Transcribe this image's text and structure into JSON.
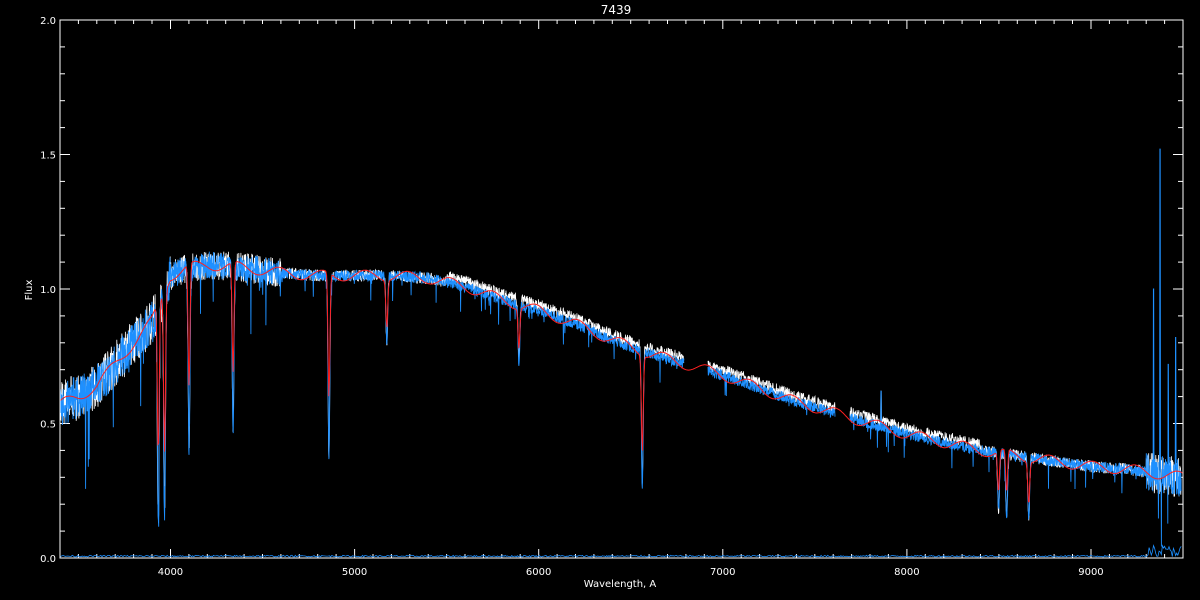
{
  "chart_data": {
    "type": "line",
    "title": "7439",
    "xlabel": "Wavelength, A",
    "ylabel": "Flux",
    "xlim": [
      3400,
      9500
    ],
    "ylim": [
      0.0,
      2.0
    ],
    "x_ticks": [
      {
        "value": 4000,
        "label": "4000"
      },
      {
        "value": 5000,
        "label": "5000"
      },
      {
        "value": 6000,
        "label": "6000"
      },
      {
        "value": 7000,
        "label": "7000"
      },
      {
        "value": 8000,
        "label": "8000"
      },
      {
        "value": 9000,
        "label": "9000"
      }
    ],
    "y_ticks": [
      {
        "value": 0.0,
        "label": "0.0"
      },
      {
        "value": 0.5,
        "label": "0.5"
      },
      {
        "value": 1.0,
        "label": "1.0"
      },
      {
        "value": 1.5,
        "label": "1.5"
      },
      {
        "value": 2.0,
        "label": "2.0"
      }
    ],
    "colors": {
      "background": "#000000",
      "axes": "#ffffff",
      "observed": "#ffffff",
      "fit": "#1e90ff",
      "model": "#ff2020"
    },
    "continuum": {
      "x": [
        3400,
        3500,
        3600,
        3700,
        3800,
        3900,
        4000,
        4100,
        4200,
        4400,
        4600,
        4800,
        5000,
        5200,
        5400,
        5600,
        5800,
        6000,
        6200,
        6400,
        6600,
        6800,
        7000,
        7200,
        7400,
        7600,
        7800,
        8000,
        8200,
        8400,
        8600,
        8800,
        9000,
        9200,
        9400,
        9500
      ],
      "y": [
        0.57,
        0.6,
        0.64,
        0.72,
        0.8,
        0.88,
        1.05,
        1.08,
        1.09,
        1.08,
        1.06,
        1.05,
        1.05,
        1.05,
        1.04,
        1.01,
        0.96,
        0.92,
        0.87,
        0.81,
        0.76,
        0.72,
        0.68,
        0.63,
        0.58,
        0.54,
        0.5,
        0.46,
        0.43,
        0.4,
        0.38,
        0.36,
        0.34,
        0.33,
        0.31,
        0.3
      ]
    },
    "absorption_lines": [
      {
        "x": 3934,
        "y": 0.13
      },
      {
        "x": 3968,
        "y": 0.15
      },
      {
        "x": 4101,
        "y": 0.42
      },
      {
        "x": 4340,
        "y": 0.5
      },
      {
        "x": 4861,
        "y": 0.38
      },
      {
        "x": 5175,
        "y": 0.8
      },
      {
        "x": 5893,
        "y": 0.73
      },
      {
        "x": 6563,
        "y": 0.26
      },
      {
        "x": 8498,
        "y": 0.17
      },
      {
        "x": 8542,
        "y": 0.15
      },
      {
        "x": 8662,
        "y": 0.15
      }
    ],
    "gaps": [
      [
        6790,
        6920
      ],
      [
        7610,
        7690
      ]
    ],
    "emission_spikes": [
      {
        "x": 7860,
        "y": 0.62
      },
      {
        "x": 9340,
        "y": 1.0
      },
      {
        "x": 9375,
        "y": 1.52
      },
      {
        "x": 9420,
        "y": 0.72
      },
      {
        "x": 9460,
        "y": 0.82
      }
    ]
  }
}
